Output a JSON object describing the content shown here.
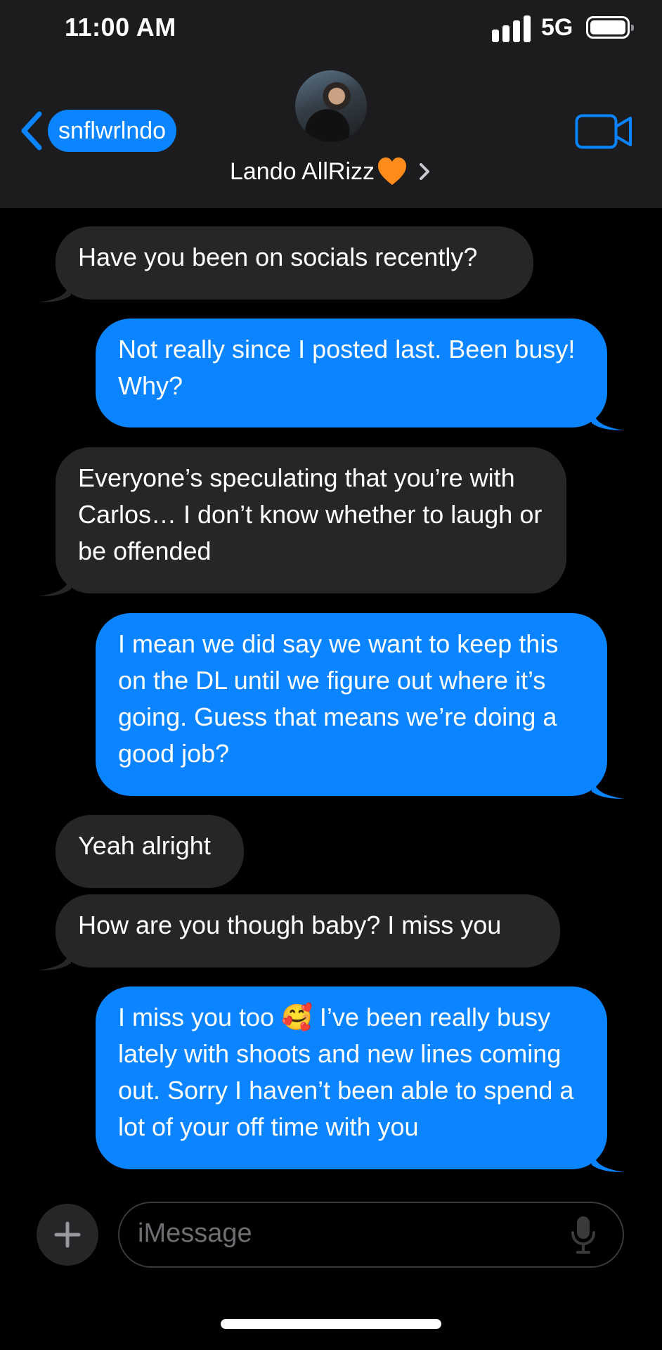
{
  "status_bar": {
    "time": "11:00 AM",
    "network": "5G"
  },
  "header": {
    "back_label": "snflwrlndo",
    "contact_name": "Lando AllRizz"
  },
  "messages": [
    {
      "from": "them",
      "text": "Have you been on socials recently?"
    },
    {
      "from": "me",
      "text": "Not really since I posted last. Been busy! Why?"
    },
    {
      "from": "them",
      "text": "Everyone’s speculating that you’re with Carlos… I don’t know whether to laugh or be offended"
    },
    {
      "from": "me",
      "text": "I mean we did say we want to keep this on the DL until we figure out where it’s going. Guess that means we’re doing a good job?"
    },
    {
      "from": "them",
      "text": "Yeah alright"
    },
    {
      "from": "them",
      "text": "How are you though baby? I miss you"
    },
    {
      "from": "me",
      "text": "I miss you too 🥰 I’ve been really busy lately with shoots and new lines coming out. Sorry I haven’t been able to spend a lot of your off time with you"
    }
  ],
  "composer": {
    "placeholder": "iMessage"
  },
  "colors": {
    "sent_bubble": "#0a84ff",
    "received_bubble": "#262628",
    "background": "#000000",
    "header": "#1c1c1e"
  }
}
